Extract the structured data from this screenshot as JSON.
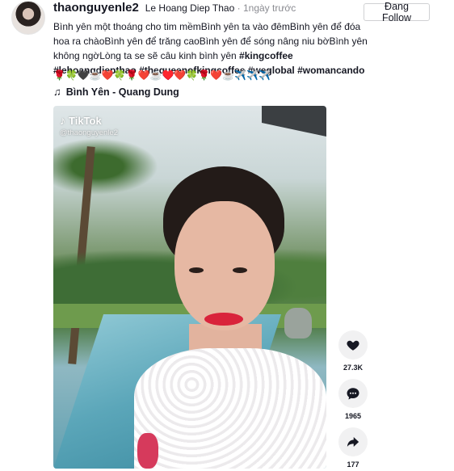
{
  "post": {
    "username": "thaonguyenle2",
    "display_name": "Le Hoang Diep Thao",
    "separator": "·",
    "time": "1ngày trước",
    "follow_label": "Đang Follow",
    "caption_text": "Bình yên một thoáng cho tim mềmBình yên ta vào đêmBình yên để đóa hoa ra chàoBình yên để trăng caoBình yên để sóng nâng niu bờBình yên không ngờLòng ta se sẽ câu kinh bình yên ",
    "hashtags": [
      "#kingcoffee",
      "#lehoangdiepthao",
      "#thequeenofkingcoffee",
      "#weglobal",
      "#womancando"
    ],
    "emoji_line": "🌹🍀🖤☕❤️🍀🌹❤️☕♥️❤️🍀🌹❤️☕✈️✈️✈️",
    "music": "Bình Yên - Quang Dung"
  },
  "video": {
    "watermark": "TikTok",
    "handle": "@thaonguyenle2"
  },
  "actions": {
    "likes": "27.3K",
    "comments": "1965",
    "shares": "177"
  },
  "icons": {
    "avatar": "avatar",
    "music": "music-note-icon",
    "like": "heart-icon",
    "comment": "comment-icon",
    "share": "share-icon",
    "tiktok": "tiktok-logo-icon"
  },
  "colors": {
    "text": "#161823",
    "muted": "#8a8b91",
    "action_bg": "#f1f1f2"
  }
}
